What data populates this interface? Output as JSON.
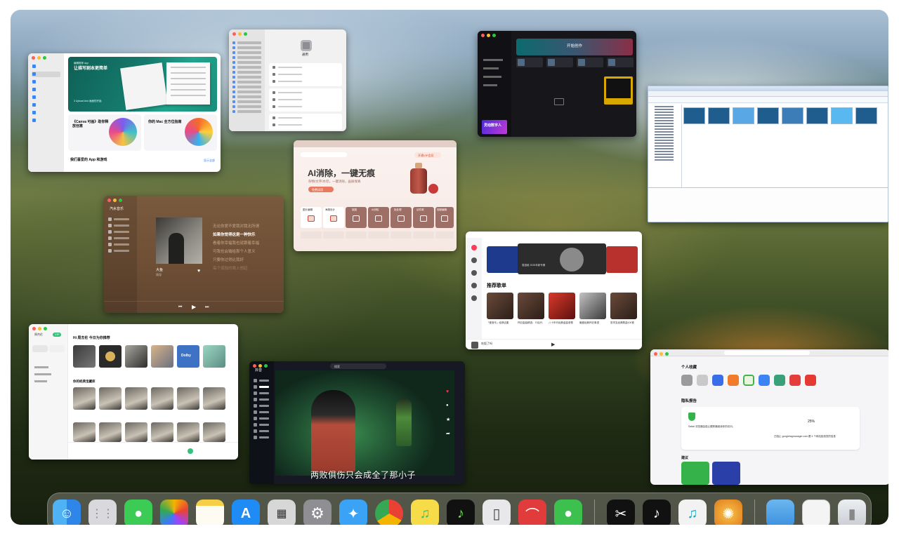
{
  "appstore": {
    "hero_tag": "编辑推荐 App",
    "hero_title": "让描写剧本更简单",
    "hero_sub": "3 Upload And 画面的开始",
    "card1_title": "《Canva 可画》助你释放创意",
    "card2_title": "你的 Mac 全方位指南",
    "section": "我们喜爱的 App 和游戏",
    "see_all": "显示全部"
  },
  "settings": {
    "title": "通用"
  },
  "darkapp": {
    "action": "开始创作",
    "promo": "灵动数字人"
  },
  "ai_app": {
    "headline": "AI消除，一键无痕",
    "sub": "杂物/文字/水印，一键消除，画质保真",
    "cta": "免费试用",
    "vip": "开通VIP会员",
    "tools": [
      "图片编辑",
      "海报设计",
      "抠图",
      "AI消除",
      "批处理",
      "证件照",
      "视频编辑"
    ]
  },
  "music": {
    "app": "汽水音乐",
    "lyrics": [
      "无论你爱不爱我对我无所谓",
      "如果你觉得这是一种快乐",
      "看着你幸福我也就跟着幸福",
      "可我也会输给那个人意义",
      "只要你过得比我好",
      "每个孤独的晚上想起"
    ],
    "song": "大鱼",
    "artist": "周深"
  },
  "netease": {
    "section": "推荐歌单",
    "banner_text": "袁娅维 2025年新专辑",
    "playlists": [
      "「爱音乐」经典合集",
      "怀旧金曲精选：70后代",
      "八十年代经典金曲老歌",
      "最爱经典怀旧粤语",
      "张学友经典歌曲100首"
    ],
    "now_playing": "吃饭了吗"
  },
  "qq": {
    "user": "周杰伦",
    "vip_badge": "VIP",
    "heading": "Hi 周杰伦 今日为你推荐",
    "sub_heading": "你的经典宝藏库",
    "dolby": "Dolby"
  },
  "douyin": {
    "app": "抖音",
    "search": "搜索",
    "subtitle": "两败俱伤只会成全了那小子",
    "menu": [
      "精选",
      "推荐",
      "关注",
      "朋友",
      "我的",
      "直播",
      "放映厅",
      "短剧"
    ]
  },
  "safari": {
    "favorites": "个人收藏",
    "privacy": "隐私报告",
    "privacy_text": "Safari 浏览器会阻止跟踪器阅读你的访问。",
    "stat_value": "25%",
    "tracker": "已阻止 googletagmanager.com 跟 4 个网站拒绝您的信息",
    "recommend": "建议"
  },
  "dock": {
    "apps": [
      "finder-icon",
      "launchpad-icon",
      "messages-icon",
      "photos-icon",
      "notes-icon",
      "app-store-icon",
      "calculator-icon",
      "system-settings-icon",
      "safari-icon",
      "chrome-icon",
      "qq-music-icon",
      "soda-music-icon",
      "iphone-mirroring-icon",
      "instruments-icon",
      "wechat-icon",
      "capcut-icon",
      "tiktok-icon",
      "music-icon",
      "xmind-icon",
      "folder-icon",
      "finder-window-icon",
      "trash-icon"
    ]
  },
  "colors": {
    "accent_red": "#fc3c55",
    "qq_green": "#31c27c",
    "ai_coral": "#e77a5e"
  }
}
